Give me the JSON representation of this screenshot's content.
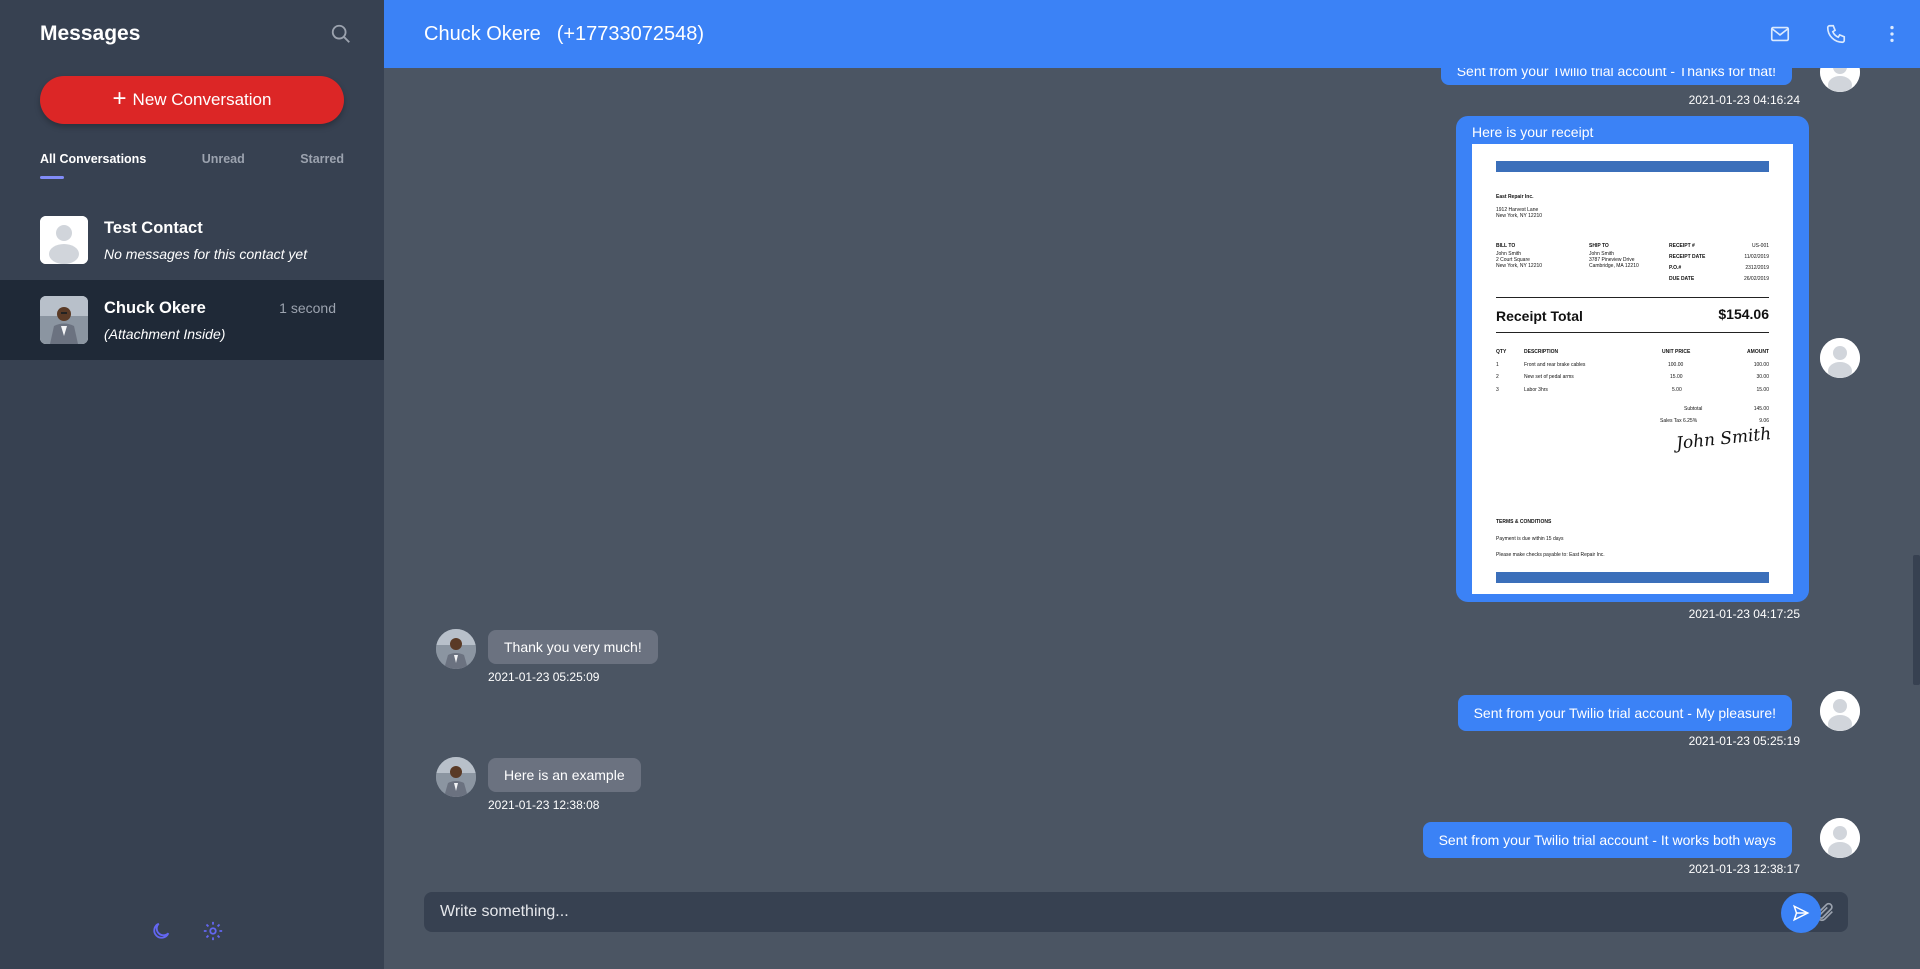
{
  "sidebar": {
    "title": "Messages",
    "new_conversation_label": "New Conversation",
    "tabs": [
      {
        "label": "All Conversations"
      },
      {
        "label": "Unread"
      },
      {
        "label": "Starred"
      }
    ],
    "conversations": [
      {
        "name": "Test Contact",
        "preview": "No messages for this contact yet",
        "time": ""
      },
      {
        "name": "Chuck Okere",
        "preview": "(Attachment Inside)",
        "time": "1 second"
      }
    ]
  },
  "header": {
    "contact_name": "Chuck Okere",
    "contact_phone": "(+17733072548)"
  },
  "messages": [
    {
      "direction": "out",
      "text": "Sent from your Twilio trial account - Thanks for that!",
      "time": "2021-01-23 04:16:24"
    },
    {
      "direction": "out",
      "text": "Here is your receipt",
      "time": "2021-01-23 04:17:25",
      "attachment": "receipt"
    },
    {
      "direction": "in",
      "text": "Thank you very much!",
      "time": "2021-01-23 05:25:09"
    },
    {
      "direction": "out",
      "text": "Sent from your Twilio trial account - My pleasure!",
      "time": "2021-01-23 05:25:19"
    },
    {
      "direction": "in",
      "text": "Here is an example",
      "time": "2021-01-23 12:38:08"
    },
    {
      "direction": "out",
      "text": "Sent from your Twilio trial account - It works both ways",
      "time": "2021-01-23 12:38:17"
    }
  ],
  "receipt": {
    "company": "East Repair Inc.",
    "address_1": "1912 Harvest Lane",
    "address_2": "New York, NY 12210",
    "bill_to_label": "BILL TO",
    "bill_to": [
      "John Smith",
      "2 Court Square",
      "New York, NY 12210"
    ],
    "ship_to_label": "SHIP TO",
    "ship_to": [
      "John Smith",
      "3787 Pineview Drive",
      "Cambridge, MA 12210"
    ],
    "meta_labels": [
      "RECEIPT #",
      "RECEIPT DATE",
      "P.O.#",
      "DUE DATE"
    ],
    "meta_values": [
      "US-001",
      "11/02/2019",
      "2312/2019",
      "26/02/2019"
    ],
    "total_label": "Receipt Total",
    "total_value": "$154.06",
    "col_qty": "QTY",
    "col_desc": "DESCRIPTION",
    "col_unit": "UNIT PRICE",
    "col_amount": "AMOUNT",
    "items": [
      {
        "qty": "1",
        "desc": "Front and rear brake cables",
        "unit": "100.00",
        "amount": "100.00"
      },
      {
        "qty": "2",
        "desc": "New set of pedal arms",
        "unit": "15.00",
        "amount": "30.00"
      },
      {
        "qty": "3",
        "desc": "Labor 3hrs",
        "unit": "5.00",
        "amount": "15.00"
      }
    ],
    "subtotal_label": "Subtotal",
    "subtotal_value": "145.00",
    "tax_label": "Sales Tax 6.25%",
    "tax_value": "9.06",
    "signature": "John Smith",
    "terms_label": "TERMS & CONDITIONS",
    "terms_1": "Payment is due within 15 days",
    "terms_2": "Please make checks payable to: East Repair Inc."
  },
  "composer": {
    "placeholder": "Write something..."
  },
  "icons": {
    "search": "search-icon",
    "mail": "mail-icon",
    "phone": "phone-icon",
    "more": "more-vertical-icon",
    "moon": "moon-icon",
    "settings": "gear-icon",
    "attach": "paperclip-icon",
    "send": "send-icon"
  },
  "colors": {
    "primary": "#3b82f6",
    "danger": "#dc2626",
    "accent": "#818cf8",
    "sidebar_bg": "#374151",
    "main_bg": "#4b5563"
  }
}
